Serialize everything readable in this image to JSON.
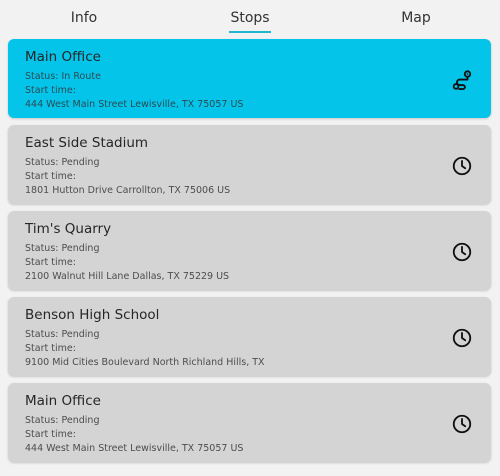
{
  "tabs": {
    "info": "Info",
    "stops": "Stops",
    "map": "Map"
  },
  "stops": [
    {
      "title": "Main Office",
      "status": "Status: In Route",
      "start_time": "Start time:",
      "address": "444 West Main Street Lewisville, TX 75057 US",
      "icon": "route-icon",
      "active": true
    },
    {
      "title": "East Side Stadium",
      "status": "Status: Pending",
      "start_time": "Start time:",
      "address": "1801 Hutton Drive Carrollton, TX 75006 US",
      "icon": "clock-icon",
      "active": false
    },
    {
      "title": "Tim's Quarry",
      "status": "Status: Pending",
      "start_time": "Start time:",
      "address": "2100 Walnut Hill Lane Dallas, TX 75229 US",
      "icon": "clock-icon",
      "active": false
    },
    {
      "title": "Benson High School",
      "status": "Status: Pending",
      "start_time": "Start time:",
      "address": "9100 Mid Cities Boulevard North Richland Hills, TX",
      "icon": "clock-icon",
      "active": false
    },
    {
      "title": "Main Office",
      "status": "Status: Pending",
      "start_time": "Start time:",
      "address": "444 West Main Street Lewisville, TX 75057 US",
      "icon": "clock-icon",
      "active": false
    }
  ],
  "colors": {
    "accent": "#04c5e9",
    "tab_indicator": "#1fb7cf",
    "card_bg": "#d4d4d5",
    "page_bg": "#f2f2f3"
  }
}
